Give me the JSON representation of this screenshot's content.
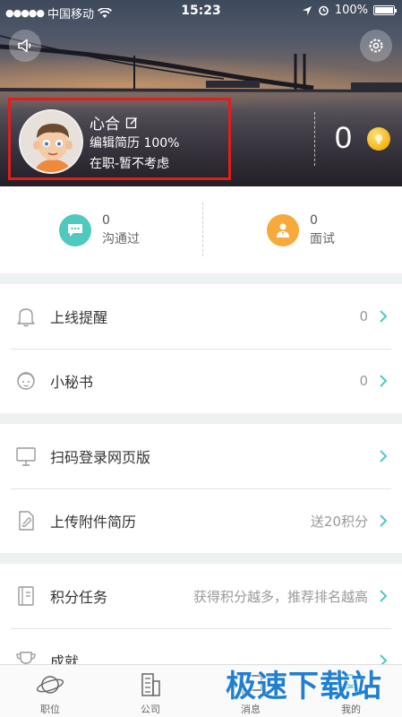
{
  "status_bar": {
    "carrier": "中国移动",
    "time": "15:23",
    "battery": "100%",
    "battery_level": 1.0
  },
  "header": {
    "speaker_icon": "speaker-icon",
    "settings_icon": "gear-icon"
  },
  "profile": {
    "name": "心合",
    "resume_progress": "编辑简历 100%",
    "job_status": "在职-暂不考虑",
    "coins": "0"
  },
  "stats": [
    {
      "count": "0",
      "label": "沟通过",
      "color": "#4ec9bf",
      "icon": "chat-icon"
    },
    {
      "count": "0",
      "label": "面试",
      "color": "#f7a93b",
      "icon": "interview-person-icon"
    }
  ],
  "menu_group_1": [
    {
      "label": "上线提醒",
      "value": "0",
      "icon": "bell-icon"
    },
    {
      "label": "小秘书",
      "value": "0",
      "icon": "secretary-icon"
    }
  ],
  "menu_group_2": [
    {
      "label": "扫码登录网页版",
      "value": "",
      "icon": "monitor-icon"
    },
    {
      "label": "上传附件简历",
      "value": "送20积分",
      "icon": "attachment-icon"
    }
  ],
  "menu_group_3": [
    {
      "label": "积分任务",
      "value": "获得积分越多，推荐排名越高",
      "icon": "task-book-icon"
    },
    {
      "label": "成就",
      "value": "",
      "icon": "trophy-icon"
    }
  ],
  "tabs": [
    {
      "label": "职位",
      "icon": "planet-icon"
    },
    {
      "label": "公司",
      "icon": "building-icon"
    },
    {
      "label": "消息",
      "icon": "message-icon"
    },
    {
      "label": "我的",
      "icon": "me-icon"
    }
  ],
  "watermark": "极速下载站",
  "colors": {
    "accent_teal": "#4ec9bf",
    "accent_orange": "#f7a93b",
    "highlight_red": "#e41c1c",
    "chevron": "#4ec9bf"
  }
}
